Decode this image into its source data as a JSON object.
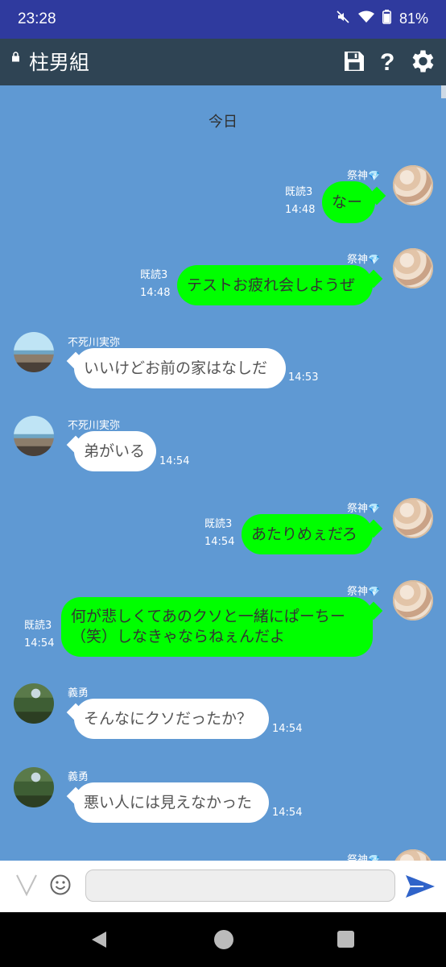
{
  "status_bar": {
    "time": "23:28",
    "battery": "81%"
  },
  "chat": {
    "title": "柱男組",
    "date_separator": "今日"
  },
  "messages": [
    {
      "sender": "祭神",
      "text": "なー",
      "read": "既読3",
      "time": "14:48"
    },
    {
      "sender": "祭神",
      "text": "テストお疲れ会しようぜ",
      "read": "既読3",
      "time": "14:48"
    },
    {
      "sender": "不死川実弥",
      "text": "いいけどお前の家はなしだ",
      "time": "14:53"
    },
    {
      "sender": "不死川実弥",
      "text": "弟がいる",
      "time": "14:54"
    },
    {
      "sender": "祭神",
      "text": "あたりめぇだろ",
      "read": "既読3",
      "time": "14:54"
    },
    {
      "sender": "祭神",
      "text_line1": "何が悲しくてあのクソと一緒にぱーちー",
      "text_line2": "（笑）しなきゃならねぇんだよ",
      "read": "既読3",
      "time": "14:54"
    },
    {
      "sender": "義勇",
      "text": "そんなにクソだったか？",
      "time": "14:54"
    },
    {
      "sender": "義勇",
      "text": "悪い人には見えなかった",
      "time": "14:54"
    },
    {
      "sender": "祭神"
    }
  ],
  "input": {
    "placeholder": ""
  },
  "icons": [
    "lock-icon",
    "save-icon",
    "help-icon",
    "settings-icon",
    "emoji-icon",
    "send-icon",
    "back-icon",
    "home-icon",
    "recents-icon"
  ],
  "colors": {
    "outgoing_bubble": "#00ff00",
    "incoming_bubble": "#ffffff",
    "chat_background": "#5f99d3"
  }
}
